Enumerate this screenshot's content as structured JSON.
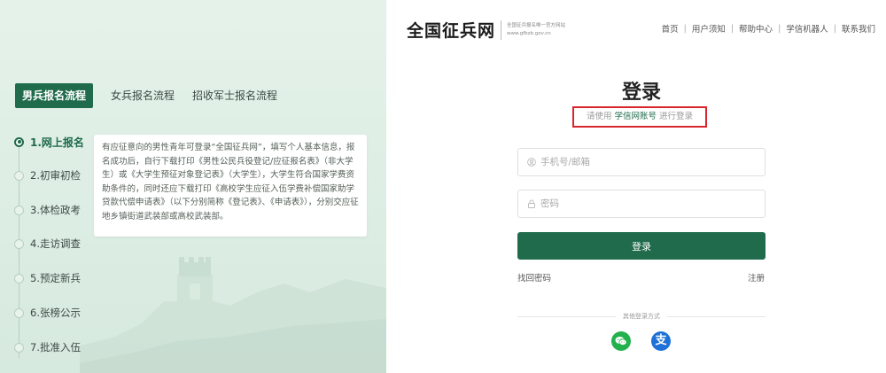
{
  "left_panel": {
    "tabs": [
      {
        "label": "男兵报名流程",
        "active": true
      },
      {
        "label": "女兵报名流程",
        "active": false
      },
      {
        "label": "招收军士报名流程",
        "active": false
      }
    ],
    "steps": [
      {
        "label": "1.网上报名",
        "active": true
      },
      {
        "label": "2.初审初检",
        "active": false
      },
      {
        "label": "3.体检政考",
        "active": false
      },
      {
        "label": "4.走访调查",
        "active": false
      },
      {
        "label": "5.预定新兵",
        "active": false
      },
      {
        "label": "6.张榜公示",
        "active": false
      },
      {
        "label": "7.批准入伍",
        "active": false
      }
    ],
    "info_text": "有应征意向的男性青年可登录“全国征兵网”，填写个人基本信息，报名成功后，自行下载打印《男性公民兵役登记/应征报名表》（非大学生）或《大学生预征对象登记表》（大学生），大学生符合国家学费资助条件的，同时还应下载打印《高校学生应征入伍学费补偿国家助学贷款代偿申请表》（以下分别简称《登记表》、《申请表》），分别交应征地乡镇街道武装部或高校武装部。"
  },
  "header": {
    "logo_title": "全国征兵网",
    "logo_subtitle_line1": "全国征兵报名唯一官方网站",
    "logo_subtitle_line2": "www.gfbzb.gov.cn",
    "nav": [
      "首页",
      "用户须知",
      "帮助中心",
      "学信机器人",
      "联系我们"
    ]
  },
  "login": {
    "title": "登录",
    "hint_prefix": "请使用",
    "hint_highlight": "学信网账号",
    "hint_suffix": "进行登录",
    "phone_placeholder": "手机号/邮箱",
    "password_placeholder": "密码",
    "login_button": "登录",
    "forgot_password": "找回密码",
    "register": "注册",
    "other_methods": "其他登录方式",
    "alipay_glyph": "支"
  },
  "colors": {
    "primary_green": "#1f6b4c",
    "highlight_red": "#d9262c",
    "wechat_green": "#22b14c",
    "alipay_blue": "#1e71d6",
    "left_bg": "#e0efe6"
  },
  "icons": [
    "user-icon",
    "lock-icon",
    "wechat-icon",
    "alipay-icon",
    "great-wall-illustration"
  ]
}
